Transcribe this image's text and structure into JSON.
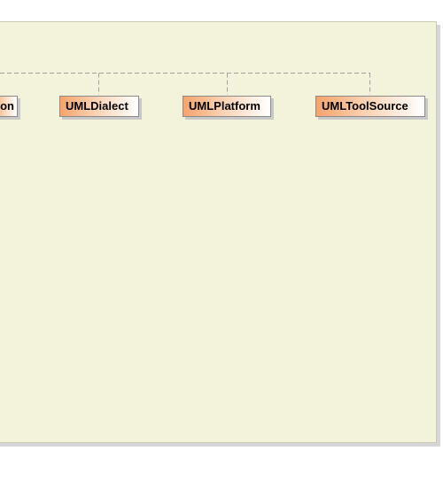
{
  "diagram": {
    "nodes": [
      {
        "id": "cut",
        "label": "on"
      },
      {
        "id": "dialect",
        "label": "UMLDialect"
      },
      {
        "id": "platform",
        "label": "UMLPlatform"
      },
      {
        "id": "toolsource",
        "label": "UMLToolSource"
      }
    ],
    "colors": {
      "canvas": "#f3f3dc",
      "node_gradient_start": "#f5a36b",
      "node_gradient_end": "#ffffff",
      "connector": "#a0a0a0"
    }
  }
}
